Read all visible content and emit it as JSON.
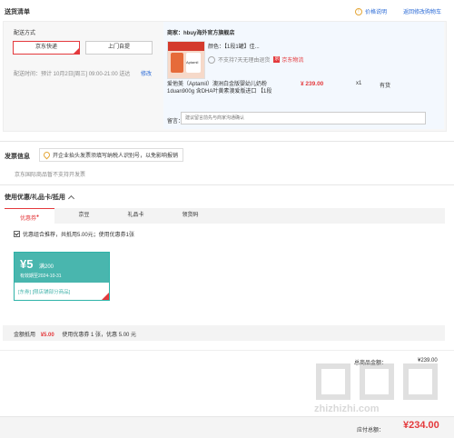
{
  "header": {
    "title": "送货清单",
    "price_note": "价格说明",
    "return_cart": "返回修改购物车"
  },
  "shipping": {
    "label": "配送方式",
    "options": [
      "京东快递",
      "上门自提"
    ],
    "time_label": "配送时间：",
    "time_value": "预计 10月2日[周三] 09:00-21:00 送达",
    "edit": "修改"
  },
  "shop": {
    "label": "商家：hbuy海外官方旗舰店",
    "attr_label": "颜色：【1段1罐】佳...",
    "no_return": "不支持7天无理由退货",
    "logistics_badge": "京",
    "logistics": "京东物流",
    "product_name": "爱他美（Aptamil）澳洲白金版婴幼儿奶粉1duan900g 含DHA叶黄素澳爱版进口 【1段",
    "price": "¥ 239.00",
    "qty": "x1",
    "stock": "有货",
    "remark_label": "留言：",
    "remark_placeholder": "建议留言前先与商家沟通确认",
    "thumb_text": "Aptamil"
  },
  "invoice": {
    "title": "发票信息",
    "notice": "开企业抬头发票须填写纳税人识别号，以免影响报销",
    "note": "京东国际商品暂不支持开发票"
  },
  "coupons": {
    "title": "使用优惠/礼品卡/抵用",
    "tabs": [
      "优惠券",
      "京豆",
      "礼品卡",
      "领货码"
    ],
    "combo_text": "优惠组合推荐，共抵用5.00元；使用优惠券1张",
    "coupon_amount": "¥5",
    "coupon_cond": "满200",
    "coupon_validity": "有效期至2024-10-31",
    "coupon_type": "[东券]",
    "coupon_scope": "[限店铺部分商品]"
  },
  "summary_bar": {
    "label": "金额抵用",
    "amount": "¥5.00",
    "desc": "使用优惠券 1 张，优惠 5.00 元"
  },
  "totals": {
    "total_label": "总商品金额：",
    "total_value": "¥239.00",
    "payable_label": "应付总额：",
    "payable_value": "¥234.00"
  },
  "watermark": "zhizhizhi.com"
}
